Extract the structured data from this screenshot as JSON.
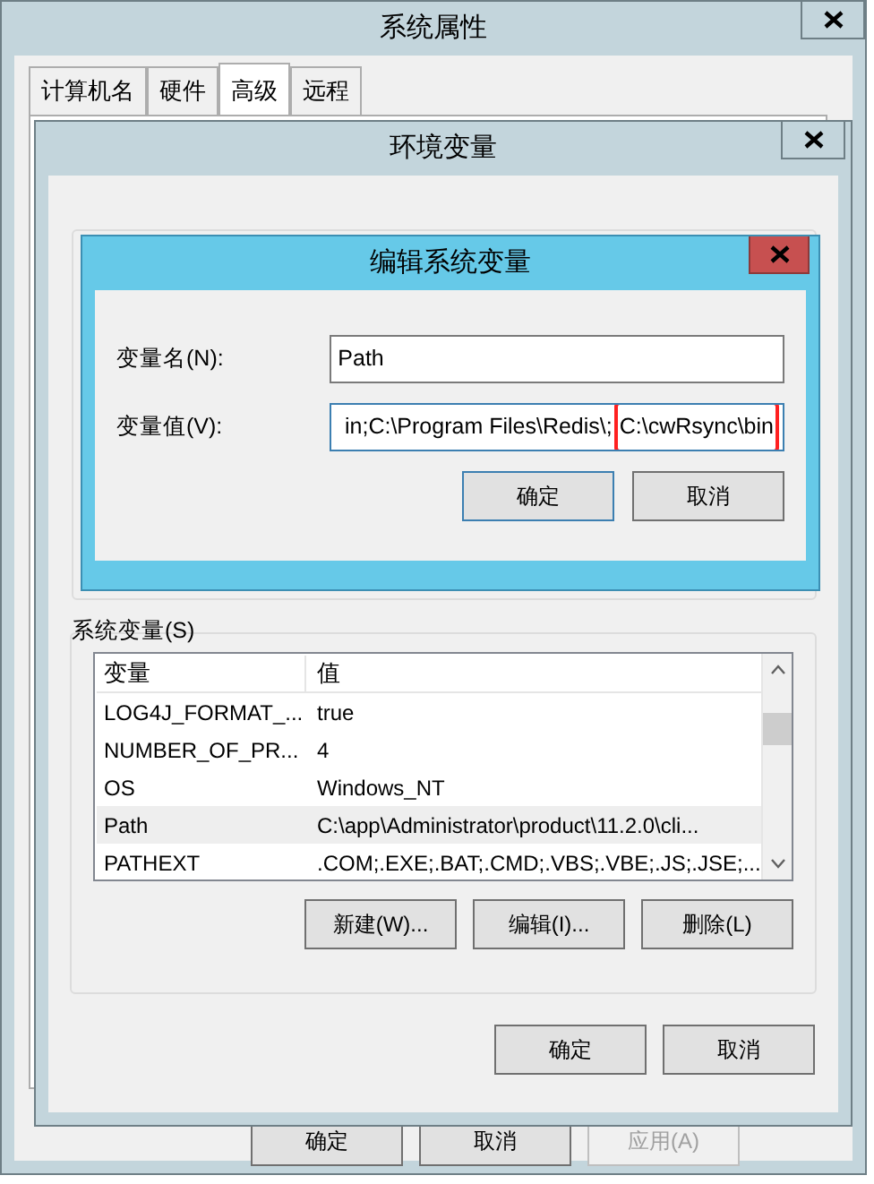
{
  "system_properties": {
    "title": "系统属性",
    "tabs": [
      {
        "label": "计算机名",
        "selected": false
      },
      {
        "label": "硬件",
        "selected": false
      },
      {
        "label": "高级",
        "selected": true
      },
      {
        "label": "远程",
        "selected": false
      }
    ],
    "buttons": [
      {
        "label": "确定",
        "disabled": false
      },
      {
        "label": "取消",
        "disabled": false
      },
      {
        "label": "应用(A)",
        "disabled": true
      }
    ]
  },
  "environment_variables": {
    "title": "环境变量",
    "system_variables": {
      "label": "系统变量(S)",
      "columns": [
        "变量",
        "值"
      ],
      "rows": [
        {
          "name": "LOG4J_FORMAT_...",
          "value": "true",
          "selected": false
        },
        {
          "name": "NUMBER_OF_PR...",
          "value": "4",
          "selected": false
        },
        {
          "name": "OS",
          "value": "Windows_NT",
          "selected": false
        },
        {
          "name": "Path",
          "value": "C:\\app\\Administrator\\product\\11.2.0\\cli...",
          "selected": true
        },
        {
          "name": "PATHEXT",
          "value": ".COM;.EXE;.BAT;.CMD;.VBS;.VBE;.JS;.JSE;...",
          "selected": false
        }
      ]
    },
    "list_buttons": [
      "新建(W)...",
      "编辑(I)...",
      "删除(L)"
    ],
    "buttons": [
      "确定",
      "取消"
    ]
  },
  "edit_dialog": {
    "title": "编辑系统变量",
    "fields": [
      {
        "label": "变量名(N):",
        "value": "Path",
        "focused": false
      },
      {
        "label": "变量值(V):",
        "value_segments": [
          {
            "text": "in;C:\\Program Files\\Redis\\;",
            "highlighted": false
          },
          {
            "text": "C:\\cwRsync\\bin",
            "highlighted": true
          }
        ],
        "focused": true
      }
    ],
    "buttons": [
      "确定",
      "取消"
    ]
  }
}
